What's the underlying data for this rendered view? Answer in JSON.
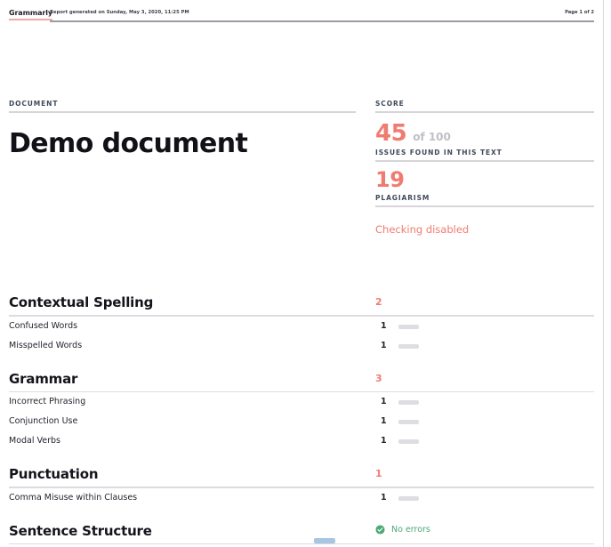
{
  "header": {
    "brand": "Grammarly",
    "meta": "Report generated on Sunday, May 3, 2020, 11:25 PM",
    "page": "Page 1 of 2"
  },
  "document_panel": {
    "label": "DOCUMENT",
    "title": "Demo document"
  },
  "score_panel": {
    "score_label": "SCORE",
    "score_value": "45",
    "score_suffix": "of 100",
    "issues_label": "ISSUES FOUND IN THIS TEXT",
    "issues_value": "19",
    "plagiarism_label": "PLAGIARISM",
    "plagiarism_value": "Checking disabled"
  },
  "colors": {
    "accent_red": "#ef7c71",
    "success_green": "#4fa878",
    "muted_gray": "#bfbfc6",
    "bar_gray": "#dedee2",
    "selection_blue": "#a8c5e2"
  },
  "categories": [
    {
      "title": "Contextual Spelling",
      "count": "2",
      "no_errors": false,
      "items": [
        {
          "label": "Confused Words",
          "count": "1"
        },
        {
          "label": "Misspelled Words",
          "count": "1"
        }
      ]
    },
    {
      "title": "Grammar",
      "count": "3",
      "no_errors": false,
      "items": [
        {
          "label": "Incorrect Phrasing",
          "count": "1"
        },
        {
          "label": "Conjunction Use",
          "count": "1"
        },
        {
          "label": "Modal Verbs",
          "count": "1"
        }
      ]
    },
    {
      "title": "Punctuation",
      "count": "1",
      "no_errors": false,
      "items": [
        {
          "label": "Comma Misuse within Clauses",
          "count": "1"
        }
      ]
    },
    {
      "title": "Sentence Structure",
      "count": "",
      "no_errors": true,
      "no_errors_label": "No errors",
      "items": []
    }
  ]
}
